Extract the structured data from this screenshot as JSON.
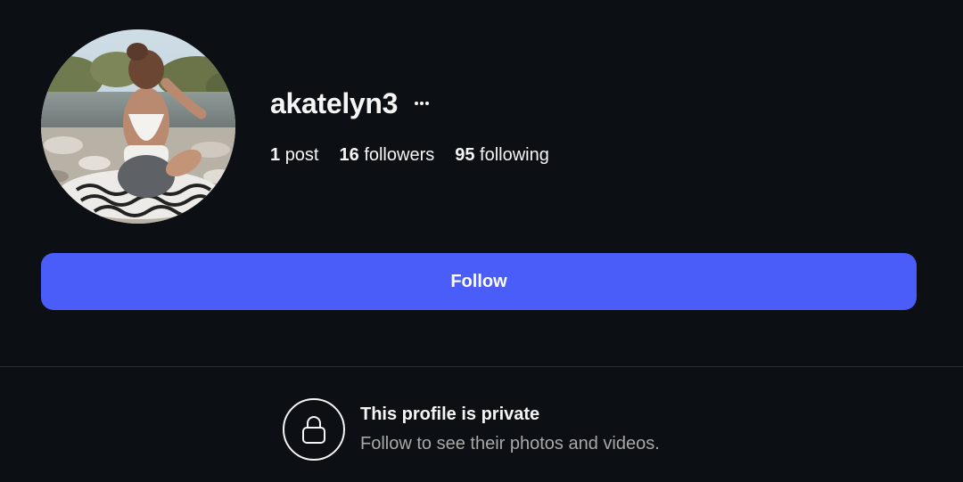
{
  "profile": {
    "username": "akatelyn3",
    "more_icon": "ellipsis-icon",
    "avatar_alt": "profile photo"
  },
  "stats": {
    "posts_count": "1",
    "posts_label": "post",
    "followers_count": "16",
    "followers_label": "followers",
    "following_count": "95",
    "following_label": "following"
  },
  "actions": {
    "follow_label": "Follow"
  },
  "private_notice": {
    "icon": "lock-icon",
    "title": "This profile is private",
    "subtitle": "Follow to see their photos and videos."
  },
  "colors": {
    "background": "#0c1014",
    "follow_button": "#4a5df9",
    "primary_text": "#f5f5f5",
    "secondary_text": "#a8a8a8",
    "divider": "#2a2f35"
  }
}
